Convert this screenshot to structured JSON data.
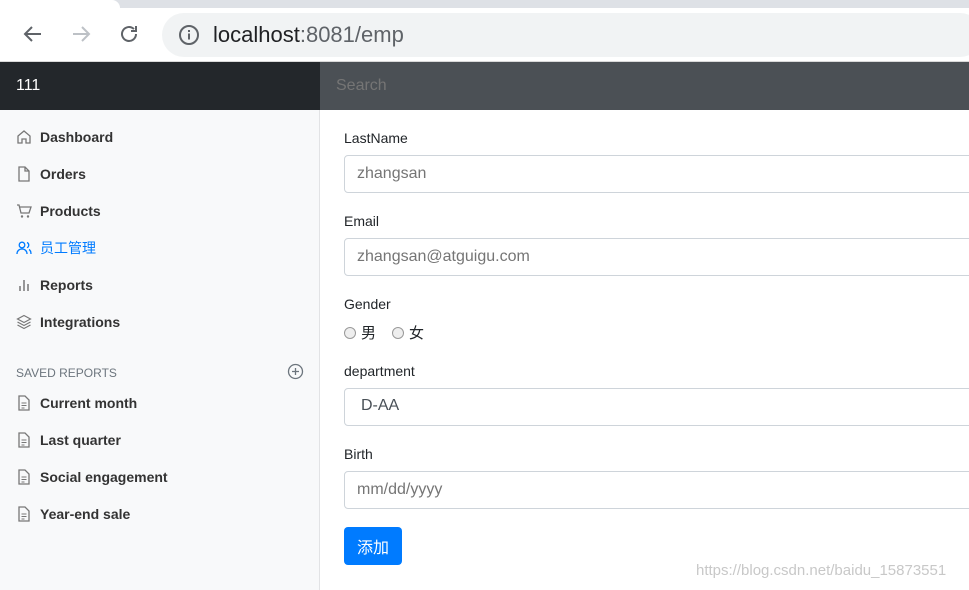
{
  "browser": {
    "url_host": "localhost",
    "url_rest": ":8081/emp"
  },
  "navbar": {
    "brand": "111",
    "search_placeholder": "Search"
  },
  "sidebar": {
    "items": [
      {
        "label": "Dashboard",
        "icon": "home-icon"
      },
      {
        "label": "Orders",
        "icon": "file-icon"
      },
      {
        "label": "Products",
        "icon": "cart-icon"
      },
      {
        "label": "员工管理",
        "icon": "users-icon",
        "active": true
      },
      {
        "label": "Reports",
        "icon": "bar-chart-icon"
      },
      {
        "label": "Integrations",
        "icon": "layers-icon"
      }
    ],
    "saved_heading": "SAVED REPORTS",
    "saved_items": [
      {
        "label": "Current month",
        "icon": "file-text-icon"
      },
      {
        "label": "Last quarter",
        "icon": "file-text-icon"
      },
      {
        "label": "Social engagement",
        "icon": "file-text-icon"
      },
      {
        "label": "Year-end sale",
        "icon": "file-text-icon"
      }
    ]
  },
  "form": {
    "lastname_label": "LastName",
    "lastname_placeholder": "zhangsan",
    "email_label": "Email",
    "email_placeholder": "zhangsan@atguigu.com",
    "gender_label": "Gender",
    "gender_options": [
      "男",
      "女"
    ],
    "department_label": "department",
    "department_value": "D-AA",
    "birth_label": "Birth",
    "birth_placeholder": "mm/dd/yyyy",
    "submit_label": "添加"
  },
  "watermark": "https://blog.csdn.net/baidu_15873551",
  "colors": {
    "accent": "#007bff",
    "navbar": "#343a40"
  }
}
